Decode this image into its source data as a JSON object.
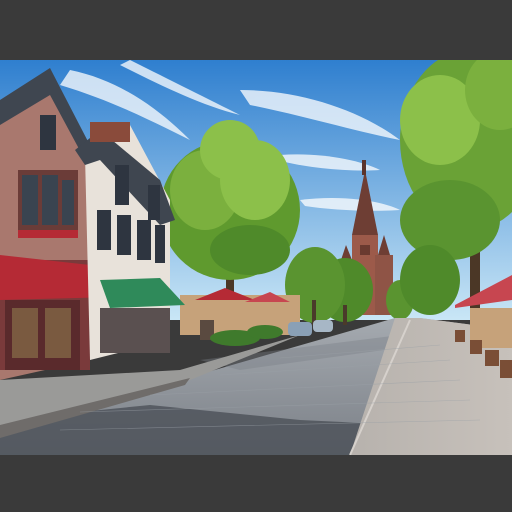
{
  "image": {
    "description_kind": "illustrated street scene",
    "colors": {
      "letterbox": "#3a3a3a",
      "sky_top": "#2f7fcf",
      "sky_bottom": "#bfe0f3",
      "foliage": "#5f9a2e",
      "foliage_light": "#8cc04a",
      "brick": "#8a4b3b",
      "awning_red": "#b52a35",
      "awning_green": "#2f8a5a",
      "cobblestone": "#8a8f96",
      "shadow": "#4b5058"
    }
  }
}
